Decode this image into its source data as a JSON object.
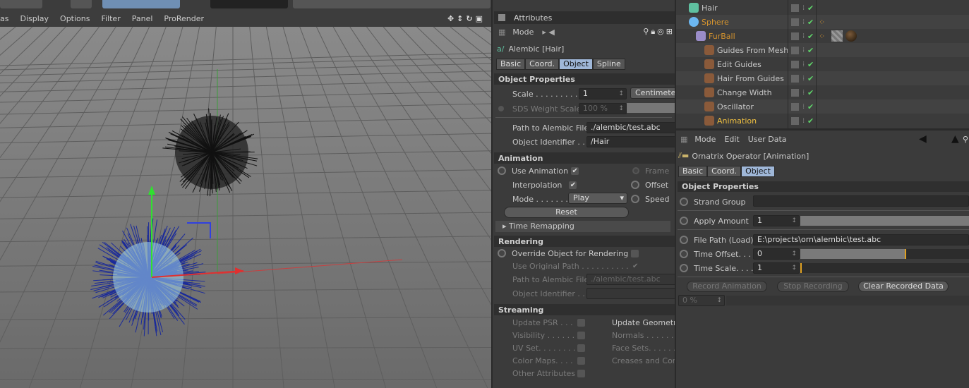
{
  "viewport": {
    "menu": [
      "as",
      "Display",
      "Options",
      "Filter",
      "Panel",
      "ProRender"
    ],
    "nav_icons": [
      "move-icon",
      "zoom-icon",
      "rotate-icon",
      "maximize-icon"
    ]
  },
  "attributes": {
    "panel_title": "Attributes",
    "mode_label": "Mode",
    "object_name": "Alembic [Hair]",
    "tabs": [
      "Basic",
      "Coord.",
      "Object",
      "Spline"
    ],
    "active_tab": "Object",
    "object_properties": {
      "header": "Object Properties",
      "scale_label": "Scale . . . . . . . . . .",
      "scale_value": "1",
      "scale_unit": "Centimeters",
      "sds_label": "SDS Weight Scale",
      "sds_value": "100 %",
      "path_label": "Path to Alembic File",
      "path_value": "./alembic/test.abc",
      "id_label": "Object Identifier . .",
      "id_value": "/Hair"
    },
    "animation": {
      "header": "Animation",
      "use_animation": "Use Animation",
      "use_animation_checked": true,
      "interpolation": "Interpolation",
      "interpolation_checked": true,
      "mode_label": "Mode . . . . . . .",
      "mode_value": "Play",
      "frame": "Frame",
      "offset": "Offset",
      "speed": "Speed",
      "reset": "Reset",
      "time_remapping": "Time Remapping"
    },
    "rendering": {
      "header": "Rendering",
      "override": "Override Object for Rendering",
      "use_original": "Use Original Path . . . . . . . . . .",
      "path_label": "Path to Alembic File",
      "path_value": "./alembic/test.abc",
      "id_label": "Object Identifier . ."
    },
    "streaming": {
      "header": "Streaming",
      "left": [
        "Update PSR . . .",
        "Visibility . . . . . .",
        "UV Set. . . . . . . .",
        "Color Maps. . . .",
        "Other Attributes"
      ],
      "right": [
        "Update Geometry",
        "Normals . . . . . .",
        "Face Sets. . . . . .",
        "Creases and Corners"
      ]
    }
  },
  "object_manager": {
    "items": [
      {
        "name": "Hair",
        "color": "#c8c8c8",
        "indent": 0,
        "icon": "alembic-icon"
      },
      {
        "name": "Sphere",
        "color": "#d4932e",
        "indent": 0,
        "icon": "sphere-icon"
      },
      {
        "name": "FurBall",
        "color": "#d4932e",
        "indent": 1,
        "icon": "furball-icon"
      },
      {
        "name": "Guides From Mesh",
        "color": "#c8c8c8",
        "indent": 2,
        "icon": "guides-from-mesh-icon"
      },
      {
        "name": "Edit Guides",
        "color": "#c8c8c8",
        "indent": 2,
        "icon": "edit-guides-icon"
      },
      {
        "name": "Hair From Guides",
        "color": "#c8c8c8",
        "indent": 2,
        "icon": "hair-from-guides-icon"
      },
      {
        "name": "Change Width",
        "color": "#c8c8c8",
        "indent": 2,
        "icon": "change-width-icon"
      },
      {
        "name": "Oscillator",
        "color": "#c8c8c8",
        "indent": 2,
        "icon": "oscillator-icon"
      },
      {
        "name": "Animation",
        "color": "#f0c040",
        "indent": 2,
        "icon": "animation-operator-icon"
      }
    ]
  },
  "operator": {
    "menu": [
      "Mode",
      "Edit",
      "User Data"
    ],
    "title": "Ornatrix Operator [Animation]",
    "tabs": [
      "Basic",
      "Coord.",
      "Object"
    ],
    "active_tab": "Object",
    "header": "Object Properties",
    "strand_group": "Strand Group",
    "apply_amount": "Apply Amount",
    "apply_amount_value": "1",
    "file_path_label": "File Path (Load)",
    "file_path_value": "E:\\projects\\orn\\alembic\\test.abc",
    "time_offset": "Time Offset. . .",
    "time_offset_value": "0",
    "time_scale": "Time Scale. . . .",
    "time_scale_value": "1",
    "record": "Record Animation",
    "stop": "Stop Recording",
    "clear": "Clear Recorded Data",
    "progress": "0 %"
  },
  "colors": {
    "accent_tab": "#9fb7d8",
    "active_object": "#d4932e",
    "selected_operator": "#f0c040"
  }
}
